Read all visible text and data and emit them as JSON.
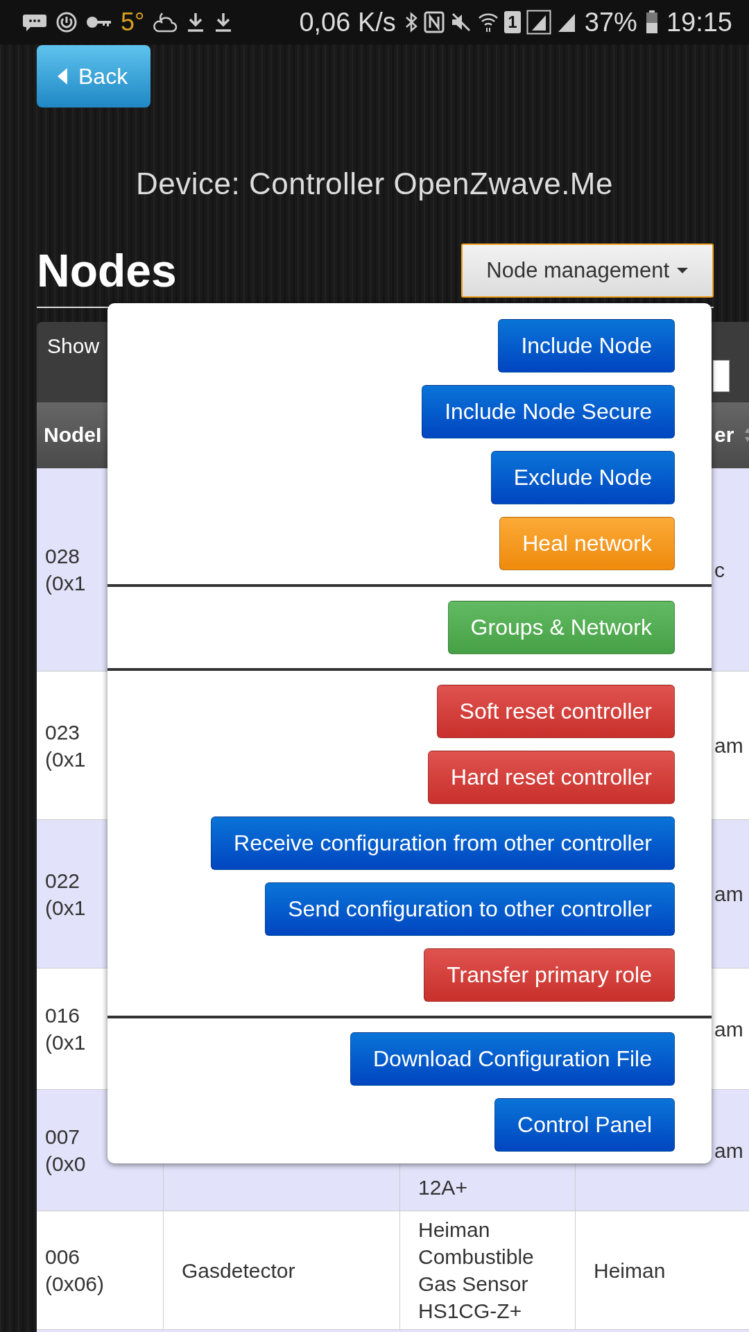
{
  "status_bar": {
    "temperature": "5°",
    "net_speed": "0,06 K/s",
    "sim_slot": "1",
    "battery": "37%",
    "time": "19:15"
  },
  "back_button": "Back",
  "title": "Device: Controller OpenZwave.Me",
  "heading": "Nodes",
  "menu_button": "Node management",
  "table": {
    "show_label": "Show",
    "header": {
      "column_1": "NodeI",
      "column_4": "er"
    },
    "rows": [
      {
        "kind": "partial",
        "node": "028",
        "hex": "(0x1",
        "column_4": "c"
      },
      {
        "kind": "partial",
        "node": "023",
        "hex": "(0x1",
        "column_4": "am"
      },
      {
        "kind": "partial",
        "node": "022",
        "hex": "(0x1",
        "column_4": "am"
      },
      {
        "kind": "partial",
        "node": "016",
        "hex": "(0x1",
        "column_4": "am"
      },
      {
        "kind": "partial",
        "node": "007",
        "hex": "(0x0",
        "column_3": "12A+",
        "column_4": "am"
      },
      {
        "kind": "full",
        "node": "006",
        "hex": "(0x06)",
        "name": "Gasdetector",
        "product": "Heiman Combustible Gas Sensor HS1CG-Z+",
        "vendor": "Heiman"
      }
    ]
  },
  "menu": {
    "sections": [
      [
        {
          "label": "Include Node",
          "kind": "primary"
        },
        {
          "label": "Include Node Secure",
          "kind": "primary"
        },
        {
          "label": "Exclude Node",
          "kind": "primary"
        },
        {
          "label": "Heal network",
          "kind": "warning"
        }
      ],
      [
        {
          "label": "Groups & Network",
          "kind": "success"
        }
      ],
      [
        {
          "label": "Soft reset controller",
          "kind": "danger"
        },
        {
          "label": "Hard reset controller",
          "kind": "danger"
        },
        {
          "label": "Receive configuration from other controller",
          "kind": "primary"
        },
        {
          "label": "Send configuration to other controller",
          "kind": "primary"
        },
        {
          "label": "Transfer primary role",
          "kind": "danger"
        }
      ],
      [
        {
          "label": "Download Configuration File",
          "kind": "primary"
        },
        {
          "label": "Control Panel",
          "kind": "primary"
        }
      ]
    ]
  }
}
